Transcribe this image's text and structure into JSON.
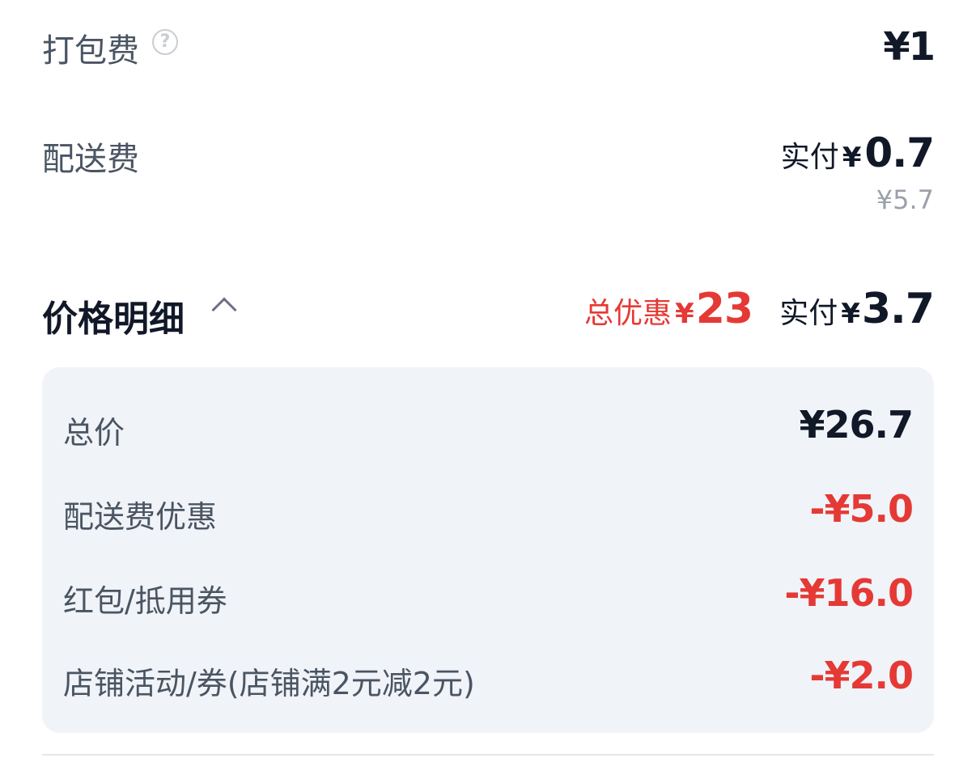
{
  "packing_fee": {
    "label": "打包费",
    "help_icon": "question-circle-icon",
    "help_glyph": "?",
    "amount": "¥1"
  },
  "delivery_fee": {
    "label": "配送费",
    "paid_prefix": "实付",
    "currency": "¥",
    "paid_value": "0.7",
    "original": "¥5.7"
  },
  "price_detail": {
    "title": "价格明细",
    "toggle_icon": "chevron-up-icon",
    "total_discount_prefix": "总优惠",
    "currency": "¥",
    "total_discount_value": "23",
    "paid_prefix": "实付",
    "paid_value": "3.7",
    "items": [
      {
        "label": "总价",
        "amount": "¥26.7",
        "type": "total"
      },
      {
        "label": "配送费优惠",
        "amount": "-¥5.0",
        "type": "discount"
      },
      {
        "label": "红包/抵用券",
        "amount": "-¥16.0",
        "type": "discount"
      },
      {
        "label": "店铺活动/券(店铺满2元减2元)",
        "amount": "-¥2.0",
        "type": "discount"
      }
    ]
  },
  "colors": {
    "discount_red": "#e53935",
    "primary_text": "#111827",
    "secondary_text": "#4a5563",
    "muted_text": "#9aa1ab",
    "panel_bg": "#f0f3f7"
  }
}
